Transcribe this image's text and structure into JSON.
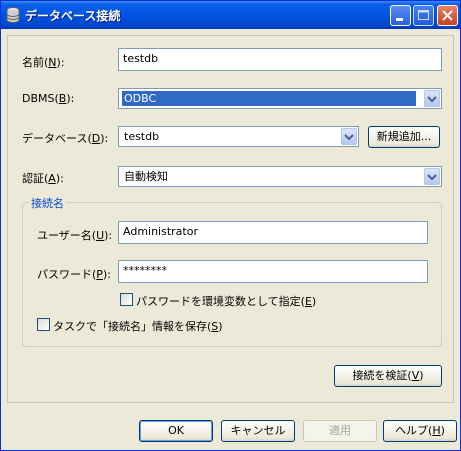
{
  "window": {
    "title": "データベース接続",
    "icon": "database-icon"
  },
  "fields": {
    "name": {
      "label_pre": "名前(",
      "label_key": "N",
      "label_post": "):",
      "value": "testdb"
    },
    "dbms": {
      "label_pre": "DBMS(",
      "label_key": "B",
      "label_post": "):",
      "value": "ODBC"
    },
    "database": {
      "label_pre": "データベース(",
      "label_key": "D",
      "label_post": "):",
      "value": "testdb",
      "new_button_pre": "新規追加...",
      "new_button_key": ""
    },
    "auth": {
      "label_pre": "認証(",
      "label_key": "A",
      "label_post": "):",
      "value": "自動検知"
    }
  },
  "connection_group": {
    "title": "接続名",
    "user": {
      "label_pre": "ユーザー名(",
      "label_key": "U",
      "label_post": "):",
      "value": "Administrator"
    },
    "password": {
      "label_pre": "パスワード(",
      "label_key": "P",
      "label_post": "):",
      "value": "********"
    },
    "env_checkbox": {
      "label_pre": "パスワードを環境変数として指定(",
      "label_key": "E",
      "label_post": ")",
      "checked": false
    },
    "save_checkbox": {
      "label_pre": "タスクで「接続名」情報を保存(",
      "label_key": "S",
      "label_post": ")",
      "checked": false
    }
  },
  "verify_button": {
    "pre": "接続を検証(",
    "key": "V",
    "post": ")"
  },
  "footer": {
    "ok": "OK",
    "cancel": "キャンセル",
    "apply": "適用",
    "help_pre": "ヘルプ(",
    "help_key": "H",
    "help_post": ")"
  },
  "colors": {
    "titlebar": "#0054e3",
    "selection": "#316ac5",
    "group_title": "#0046d5",
    "dialog_bg": "#ece9d8"
  }
}
